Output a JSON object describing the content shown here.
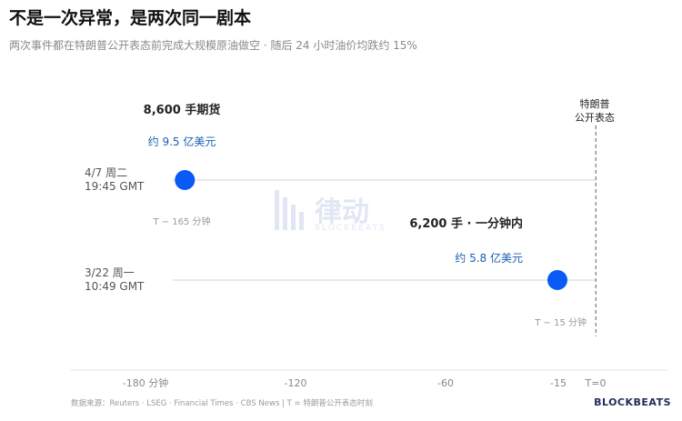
{
  "title": "不是一次异常，是两次同一剧本",
  "subtitle": "两次事件都在特朗普公开表态前完成大规模原油做空 · 随后 24 小时油价均跌约 15%",
  "footer": "数据来源：Reuters · LSEG · Financial Times · CBS News | T = 特朗普公开表态时刻",
  "brand": "BLOCKBEATS",
  "watermark": {
    "main": "律动",
    "sub": "BLOCKBEATS"
  },
  "colors": {
    "dot": "#0a5af5",
    "blue_text": "#1a5fb4",
    "gray": "#999999",
    "dark": "#222222"
  },
  "chart_data": {
    "type": "scatter",
    "x_unit": "分钟 relative to T",
    "xlim": [
      -200,
      20
    ],
    "x_ticks": [
      {
        "value": -180,
        "label": "-180 分钟"
      },
      {
        "value": -120,
        "label": "-120"
      },
      {
        "value": -60,
        "label": "-60"
      },
      {
        "value": -15,
        "label": "-15"
      },
      {
        "value": 0,
        "label": "T=0"
      }
    ],
    "reference_line": {
      "x": 0,
      "label_line1": "特朗普",
      "label_line2": "公开表态"
    },
    "events": [
      {
        "row_label_line1": "4/7 周二",
        "row_label_line2": "19:45 GMT",
        "x": -165,
        "headline": "8,600 手期货",
        "value_text": "约 9.5 亿美元",
        "lots": 8600,
        "usd_billion_yi": 9.5,
        "offset_label": "T − 165 分钟"
      },
      {
        "row_label_line1": "3/22 周一",
        "row_label_line2": "10:49 GMT",
        "x": -15,
        "headline": "6,200 手 · 一分钟内",
        "value_text": "约 5.8 亿美元",
        "lots": 6200,
        "usd_billion_yi": 5.8,
        "offset_label": "T − 15 分钟"
      }
    ]
  }
}
